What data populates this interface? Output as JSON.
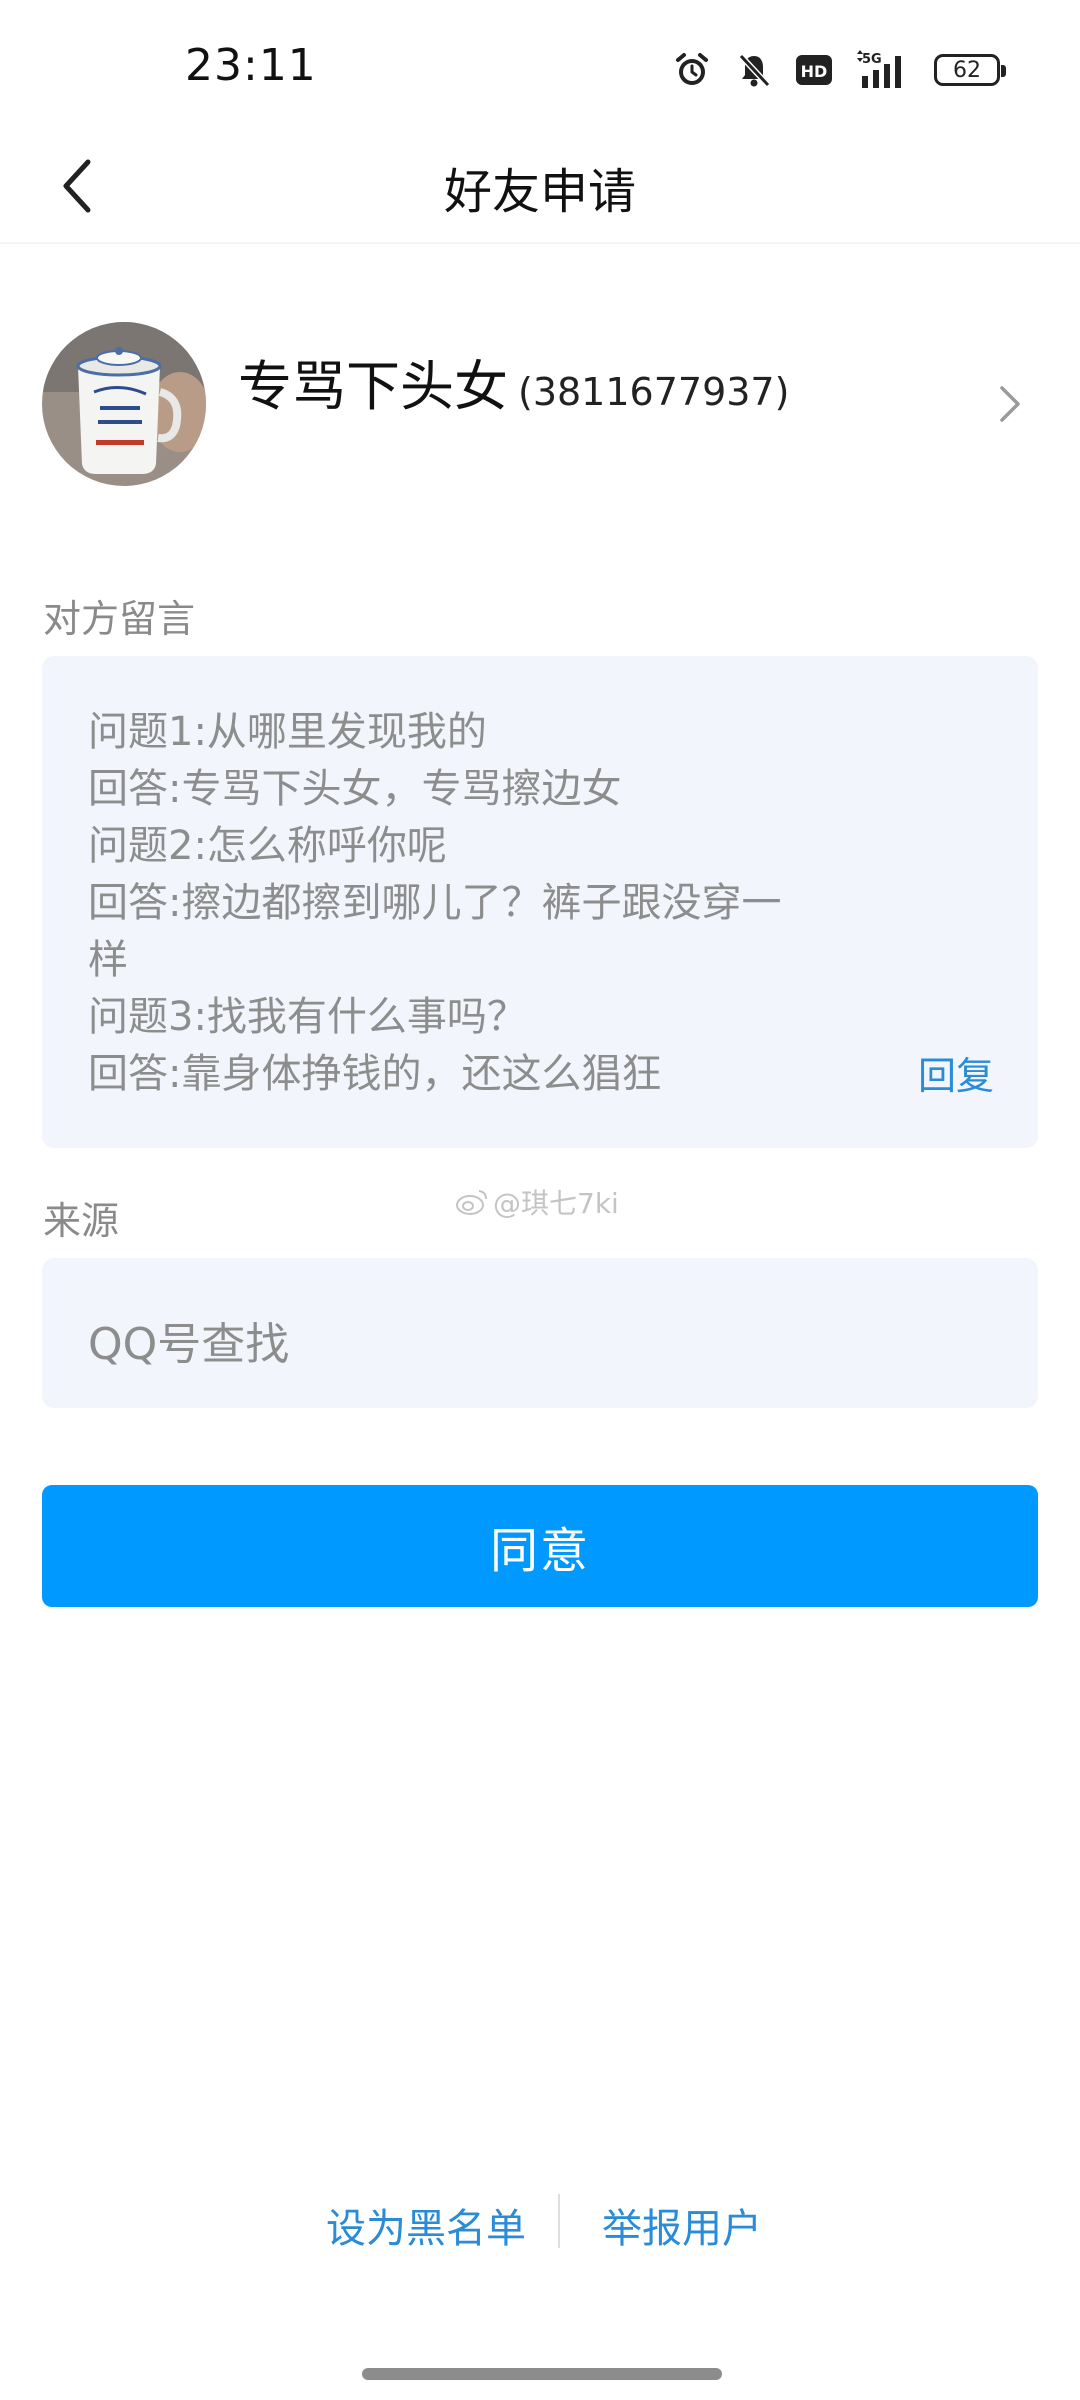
{
  "status_bar": {
    "time": "23:11",
    "network": "5G",
    "hd": "HD",
    "battery": "62"
  },
  "nav": {
    "title": "好友申请"
  },
  "profile": {
    "name": "专骂下头女",
    "qq_id": "(3811677937)"
  },
  "message_section": {
    "label": "对方留言",
    "lines": [
      "问题1:从哪里发现我的",
      "回答:专骂下头女，专骂擦边女",
      "问题2:怎么称呼你呢",
      "回答:擦边都擦到哪儿了？裤子跟没穿一",
      "样",
      "问题3:找我有什么事吗？",
      "回答:靠身体挣钱的，还这么猖狂"
    ],
    "reply_label": "回复"
  },
  "source_section": {
    "label": "来源",
    "value": "QQ号查找"
  },
  "watermark": "@琪七7ki",
  "agree_button": "同意",
  "bottom_links": {
    "blacklist": "设为黑名单",
    "report": "举报用户"
  },
  "colors": {
    "accent": "#0099ff",
    "link": "#2a8bd6",
    "box_bg": "#f2f6fc",
    "muted_text": "#8d8d8d"
  }
}
